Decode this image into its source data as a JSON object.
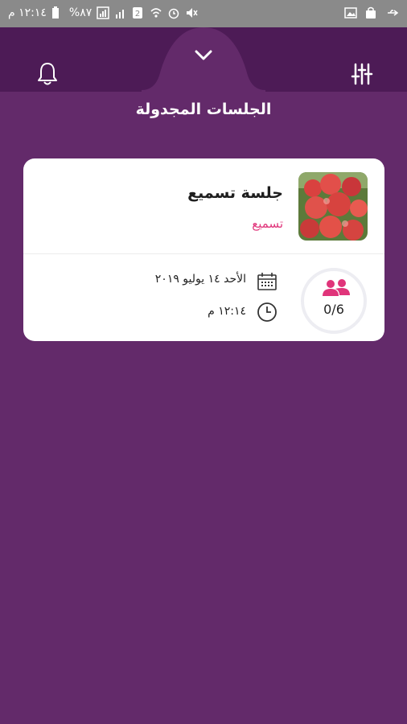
{
  "status_bar": {
    "time": "١٢:١٤ م",
    "battery": "%٨٧"
  },
  "page": {
    "title": "الجلسات المجدولة"
  },
  "session": {
    "name": "جلسة تسميع",
    "type": "تسميع",
    "date": "الأحد ١٤ يوليو ٢٠١٩",
    "time": "١٢:١٤ م",
    "capacity": "0/6"
  },
  "colors": {
    "background": "#632a6a",
    "header": "#4d1b56",
    "accent_pink": "#e0347a"
  },
  "icons": [
    "chevron-down-icon",
    "bell-icon",
    "filter-sliders-icon",
    "calendar-icon",
    "clock-icon",
    "people-icon"
  ]
}
